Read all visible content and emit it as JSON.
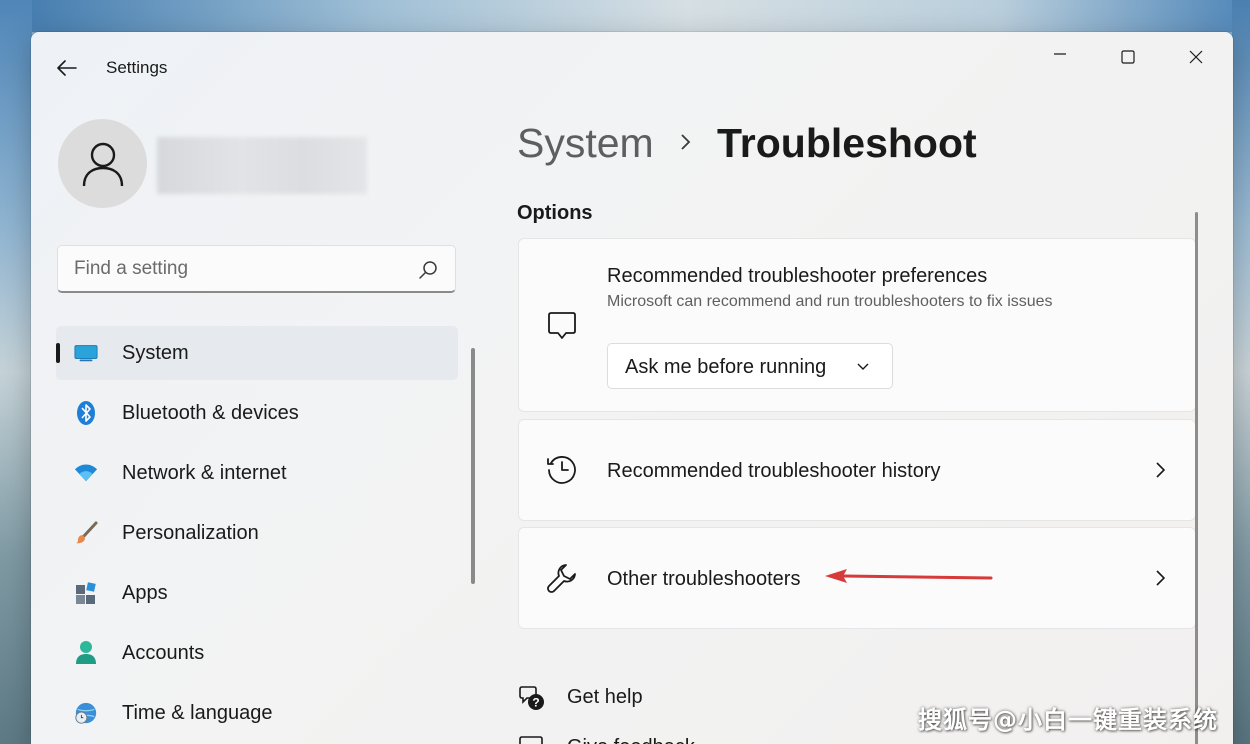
{
  "window": {
    "title": "Settings",
    "controls": [
      "minimize-icon",
      "maximize-icon",
      "close-icon"
    ]
  },
  "sidebar": {
    "search": {
      "placeholder": "Find a setting",
      "value": ""
    },
    "items": [
      {
        "label": "System",
        "icon": "display-icon",
        "active": true
      },
      {
        "label": "Bluetooth & devices",
        "icon": "bluetooth-icon",
        "active": false
      },
      {
        "label": "Network & internet",
        "icon": "wifi-icon",
        "active": false
      },
      {
        "label": "Personalization",
        "icon": "brush-icon",
        "active": false
      },
      {
        "label": "Apps",
        "icon": "apps-icon",
        "active": false
      },
      {
        "label": "Accounts",
        "icon": "person-icon",
        "active": false
      },
      {
        "label": "Time & language",
        "icon": "globe-clock-icon",
        "active": false
      }
    ]
  },
  "main": {
    "breadcrumb": {
      "parent": "System",
      "current": "Troubleshoot"
    },
    "section_title": "Options",
    "cards": [
      {
        "title": "Recommended troubleshooter preferences",
        "description": "Microsoft can recommend and run troubleshooters to fix issues",
        "icon": "chat-bubble-icon",
        "dropdown_value": "Ask me before running"
      },
      {
        "title": "Recommended troubleshooter history",
        "icon": "history-icon"
      },
      {
        "title": "Other troubleshooters",
        "icon": "wrench-icon"
      }
    ],
    "links": [
      {
        "label": "Get help",
        "icon": "help-chat-icon"
      },
      {
        "label": "Give feedback",
        "icon": "feedback-icon"
      }
    ]
  },
  "watermark": "搜狐号@小白一键重装系统",
  "colors": {
    "accent": "#0078d4",
    "annotation_arrow": "#d63a3a"
  }
}
